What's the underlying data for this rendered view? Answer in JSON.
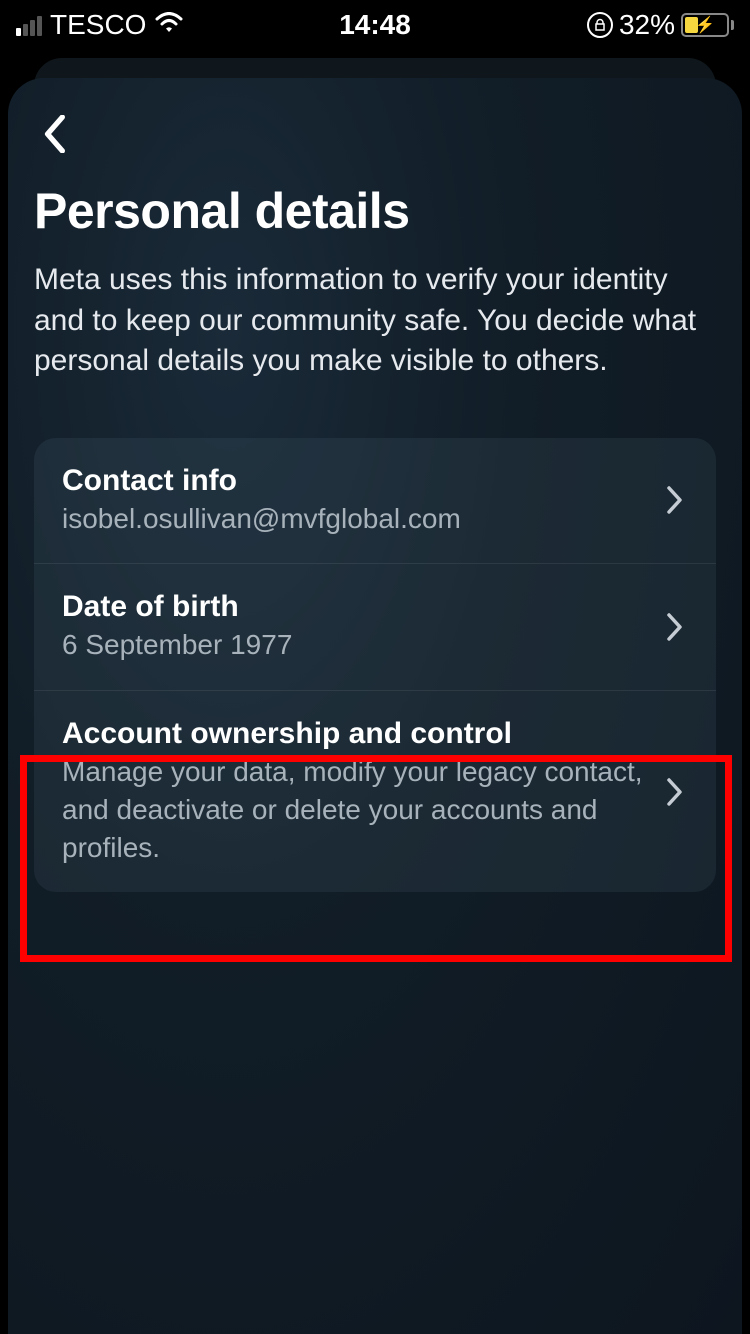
{
  "status_bar": {
    "carrier": "TESCO",
    "time": "14:48",
    "battery_percent": "32%"
  },
  "header": {
    "title": "Personal details",
    "description": "Meta uses this information to verify your identity and to keep our community safe. You decide what personal details you make visible to others."
  },
  "list": {
    "contact_info": {
      "title": "Contact info",
      "value": "isobel.osullivan@mvfglobal.com"
    },
    "dob": {
      "title": "Date of birth",
      "value": "6 September 1977"
    },
    "ownership": {
      "title": "Account ownership and control",
      "description": "Manage your data, modify your legacy contact, and deactivate or delete your accounts and profiles."
    }
  }
}
